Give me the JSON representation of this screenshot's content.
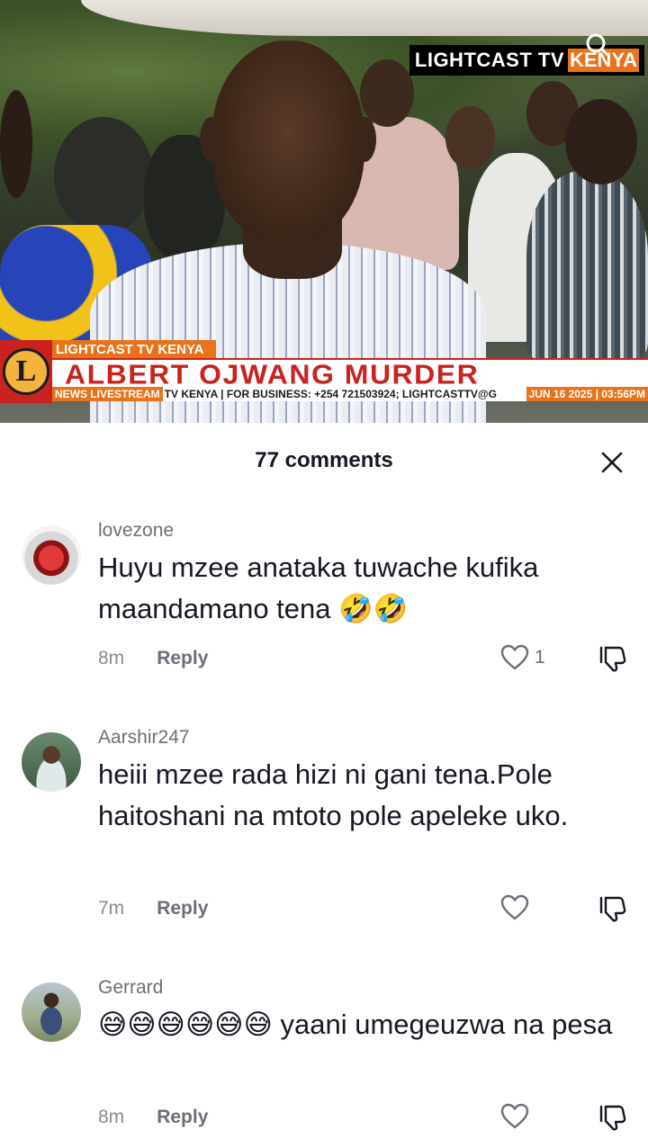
{
  "video": {
    "watermark_part1": "LIGHTCAST TV",
    "watermark_part2": "KENYA",
    "lower_third": {
      "channel_label": "LIGHTCAST TV KENYA",
      "headline": "ALBERT OJWANG MURDER",
      "live_label": "NEWS LIVESTREAM",
      "ticker": "TV KENYA | FOR BUSINESS: +254 721503924; LIGHTCASTTV@G",
      "datetime": "JUN 16 2025 | 03:56PM"
    }
  },
  "comments_panel": {
    "title": "77 comments",
    "comments": [
      {
        "username": "lovezone",
        "text": "Huyu mzee anataka tuwache kufika maandamano tena 🤣🤣",
        "time": "8m",
        "reply_label": "Reply",
        "likes": "1"
      },
      {
        "username": "Aarshir247",
        "text": "heiii mzee rada hizi ni gani tena.Pole haitoshani na mtoto pole apeleke uko.",
        "time": "7m",
        "reply_label": "Reply",
        "likes": ""
      },
      {
        "username": "Gerrard",
        "text": "😅😅😅😅😅😅 yaani umegeuzwa na pesa",
        "time": "8m",
        "reply_label": "Reply",
        "likes": ""
      }
    ]
  },
  "colors": {
    "accent_orange": "#e8731a",
    "headline_red": "#c8231f",
    "text_dark": "#161823",
    "text_muted": "#6c6f78"
  },
  "icons": [
    "search-icon",
    "close-icon",
    "heart-icon",
    "dislike-icon",
    "channel-logo"
  ]
}
